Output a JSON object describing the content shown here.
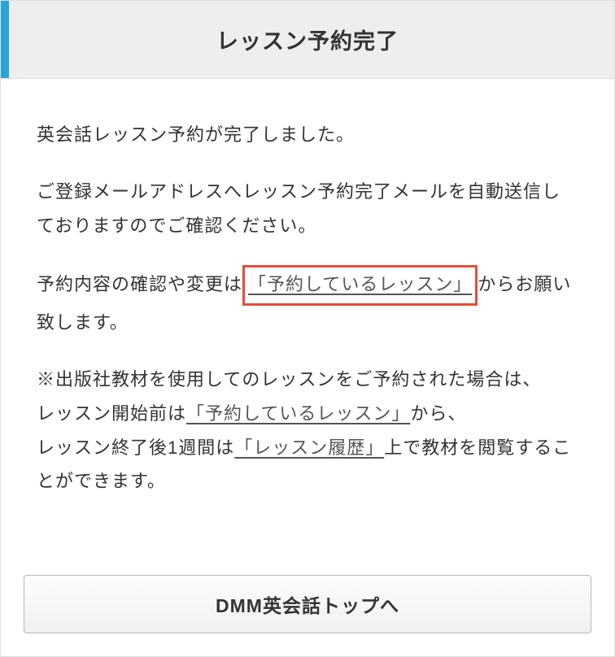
{
  "header": {
    "title": "レッスン予約完了"
  },
  "content": {
    "p1": "英会話レッスン予約が完了しました。",
    "p2": "ご登録メールアドレスへレッスン予約完了メールを自動送信しておりますのでご確認ください。",
    "p3_before": "予約内容の確認や変更は",
    "p3_link": "「予約しているレッスン」",
    "p3_after": "からお願い致します。",
    "p4_l1": "※出版社教材を使用してのレッスンをご予約された場合は、",
    "p4_l2a": "レッスン開始前は",
    "p4_link1": "「予約しているレッスン」",
    "p4_l2b": "から、",
    "p4_l3a": "レッスン終了後1週間は",
    "p4_link2": "「レッスン履歴」",
    "p4_l3b": "上で教材を閲覧することができます。"
  },
  "footer": {
    "button_label": "DMM英会話トップへ"
  }
}
